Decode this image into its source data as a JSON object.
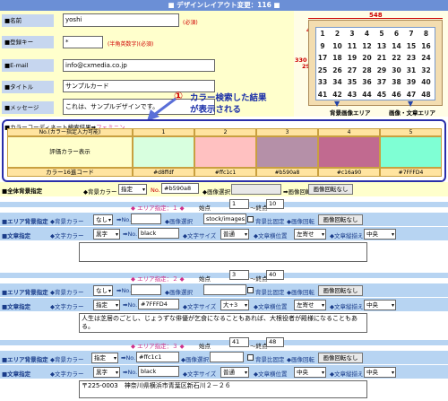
{
  "title": "■ デザインレイアウト変更：116 ■",
  "form": {
    "name": {
      "label": "■名前",
      "value": "yoshi",
      "req": "(必須)"
    },
    "key": {
      "label": "■登録キー",
      "value": "*",
      "req": "(半角英数字)(必須)"
    },
    "email": {
      "label": "■E-mail",
      "value": "info@cxmedia.co.jp"
    },
    "title": {
      "label": "■タイトル",
      "value": "サンプルカード"
    },
    "message": {
      "label": "■メッセージ",
      "value": "これは、サンプルデザインです。"
    }
  },
  "grid": {
    "w548": "548",
    "w512": "512",
    "d46": "46",
    "d64": "64",
    "h330": "330",
    "h294": "294",
    "nums": [
      "1",
      "2",
      "3",
      "4",
      "5",
      "6",
      "7",
      "8",
      "9",
      "10",
      "11",
      "12",
      "13",
      "14",
      "15",
      "16",
      "17",
      "18",
      "19",
      "20",
      "21",
      "22",
      "23",
      "24",
      "25",
      "26",
      "27",
      "28",
      "29",
      "30",
      "31",
      "32",
      "33",
      "34",
      "35",
      "36",
      "37",
      "38",
      "39",
      "40",
      "41",
      "42",
      "43",
      "44",
      "45",
      "46",
      "47",
      "48"
    ],
    "legend_bg": "背景画像エリア",
    "legend_img": "画像・文章エリア"
  },
  "annot": {
    "num": "①",
    "line1": "カラー検索した結果",
    "line2": "が表示される"
  },
  "color": {
    "head": "■カラーコーディネート検索結果➡",
    "link": "フェミニン",
    "row_label": "No.(カラー指定入力可能)",
    "cols": [
      "1",
      "2",
      "3",
      "4",
      "5"
    ],
    "disp": "評価カラー表示",
    "code_label": "カラー16進コード",
    "codes": [
      "#d8ffdf",
      "#ffc1c1",
      "#b590a8",
      "#c16a90",
      "#7FFFD4"
    ],
    "swatches": [
      "#d8ffdf",
      "#ffc1c1",
      "#b590a8",
      "#c16a90",
      "#7fffd4"
    ]
  },
  "bg": {
    "label": "■全体背景指定",
    "bgcolor": "◆背景カラー",
    "sel": "指定",
    "no": "No.",
    "code": "#b590a8",
    "img": "◆画像選択",
    "img_sel": "➡画像回転",
    "rot": "画像回転なし"
  },
  "areas": [
    {
      "title": "◆ エリア指定：１ ◆",
      "start_l": "始点",
      "start": "1",
      "end_l": "～終点",
      "end": "10",
      "row1": {
        "label": "■エリア背景指定",
        "bgcolor": "◆背景カラー",
        "sel": "なし",
        "no": "➡No.",
        "img": "◆画像選択",
        "imgval": "stock/images.",
        "chk": "背景比固定",
        "rot_l": "◆画像回転",
        "rot": "画像回転なし"
      },
      "row2": {
        "label": "■文章指定",
        "color_l": "◆文字カラー",
        "color_sel": "黒字",
        "no": "➡No.",
        "code": "black",
        "size_l": "◆文字サイズ",
        "size": "普通",
        "halign_l": "◆文章横位置",
        "halign": "左寄せ",
        "valign_l": "◆文章縦揃え",
        "valign": "中央"
      },
      "text": ""
    },
    {
      "title": "◆ エリア指定：２ ◆",
      "start_l": "始点",
      "start": "3",
      "end_l": "～終点",
      "end": "40",
      "row1": {
        "label": "■エリア背景指定",
        "bgcolor": "◆背景カラー",
        "sel": "なし",
        "no": "➡No.",
        "img": "◆画像選択",
        "imgval": "",
        "chk": "背景比固定",
        "rot_l": "◆画像回転",
        "rot": "画像回転なし"
      },
      "row2": {
        "label": "■文章指定",
        "color_l": "◆文字カラー",
        "color_sel": "指定",
        "no": "➡No.",
        "code": "#7FFFD4",
        "size_l": "◆文字サイズ",
        "size": "大+3",
        "halign_l": "◆文章横位置",
        "halign": "左寄せ",
        "valign_l": "◆文章縦揃え",
        "valign": "中央"
      },
      "text": "人生は芝居のごとし、じょうずな俳優が乞食になることもあれば、大根役者が殿様になることもある。"
    },
    {
      "title": "◆ エリア指定：３ ◆",
      "start_l": "始点",
      "start": "41",
      "end_l": "～終点",
      "end": "48",
      "row1": {
        "label": "■エリア背景指定",
        "bgcolor": "◆背景カラー",
        "sel": "指定",
        "no": "➡No.",
        "img": "◆画像選択",
        "code": "#ffc1c1",
        "chk": "背景比固定",
        "rot_l": "◆画像回転",
        "rot": "画像回転なし"
      },
      "row2": {
        "label": "■文章指定",
        "color_l": "◆文字カラー",
        "color_sel": "黒字",
        "no": "➡No.",
        "code": "black",
        "size_l": "◆文字サイズ",
        "size": "普通",
        "halign_l": "◆文章横位置",
        "halign": "中央",
        "valign_l": "◆文章縦揃え",
        "valign": "中央"
      },
      "text": "〒225-0003　神奈川県横浜市青葉区新石川２－２６"
    }
  ]
}
